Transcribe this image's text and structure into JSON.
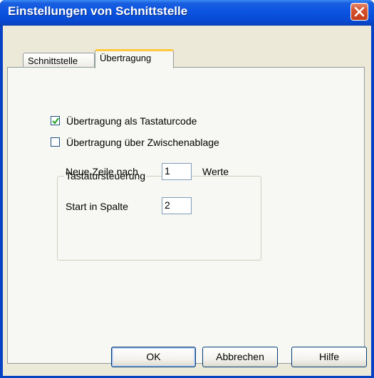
{
  "window": {
    "title": "Einstellungen von Schnittstelle"
  },
  "tabs": [
    {
      "label": "Schnittstelle",
      "active": false
    },
    {
      "label": "Übertragung",
      "active": true
    }
  ],
  "options": {
    "keyboard": {
      "label": "Übertragung als Tastaturcode",
      "checked": true
    },
    "clipboard": {
      "label": "Übertragung über Zwischenablage",
      "checked": false
    }
  },
  "keyboard_group": {
    "title": "Tastatursteuerung",
    "newline_label": "Neue Zeile nach",
    "newline_value": "1",
    "newline_unit": "Werte",
    "start_label": "Start in Spalte",
    "start_value": "2"
  },
  "buttons": {
    "ok": "OK",
    "cancel": "Abbrechen",
    "help": "Hilfe"
  },
  "colors": {
    "titlebar": "#0a54e2",
    "dialog_bg": "#ece9d8",
    "close_button": "#d5532e",
    "active_tab_accent": "#ffc83c"
  },
  "icons": {
    "close": "close-icon",
    "check": "checkmark-icon"
  }
}
